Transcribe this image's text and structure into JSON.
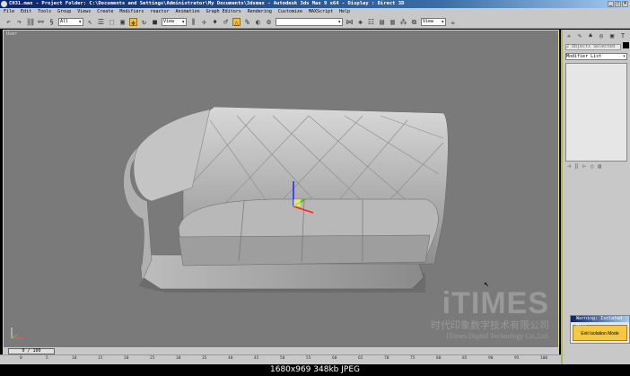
{
  "title": "CH31.max   - Project Folder: C:\\Documents and Settings\\Administrator\\My Documents\\3dsmax   - Autodesk 3ds Max 9 x64   - Display : Direct 3D",
  "menu": [
    "File",
    "Edit",
    "Tools",
    "Group",
    "Views",
    "Create",
    "Modifiers",
    "reactor",
    "Animation",
    "Graph Editors",
    "Rendering",
    "Customize",
    "MAXScript",
    "Help"
  ],
  "toolbar": {
    "selection_filter": "All",
    "ref_coord": "View",
    "render_view": "View"
  },
  "viewport": {
    "label": "User"
  },
  "watermark": {
    "logo": "iTIMES",
    "cn": "时代印象数字技术有限公司",
    "en": "ITimes Digital Technology Co.,Ltd."
  },
  "command_panel": {
    "selection": "2 Objects Selected",
    "modifier_list": "Modifier List"
  },
  "warning": {
    "title": "Warning: Isolated S...",
    "button": "Exit Isolation Mode"
  },
  "timeline": {
    "frame": "0 / 100",
    "ticks": [
      "0",
      "5",
      "10",
      "15",
      "20",
      "25",
      "30",
      "35",
      "40",
      "45",
      "50",
      "55",
      "60",
      "65",
      "70",
      "75",
      "80",
      "85",
      "90",
      "95",
      "100"
    ]
  },
  "footer": "1680x969  348kb  JPEG"
}
